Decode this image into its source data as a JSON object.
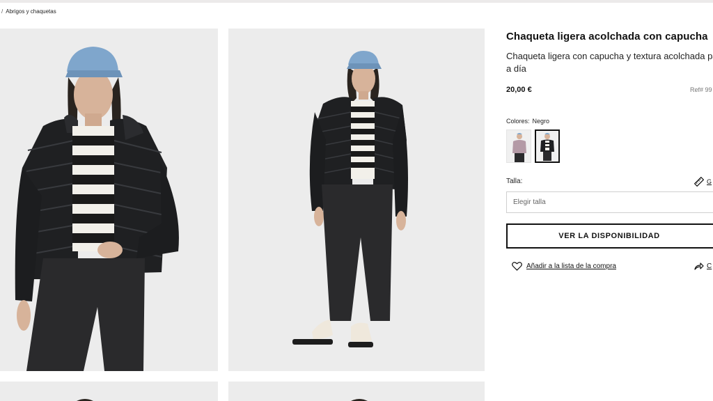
{
  "breadcrumb": {
    "separator": "/",
    "current": "Abrigos y chaquetas"
  },
  "product": {
    "title": "Chaqueta ligera acolchada con capucha",
    "description": "Chaqueta ligera con capucha y textura acolchada pa día a día",
    "price": "20,00 €",
    "ref": "Ref# 99"
  },
  "colors": {
    "label": "Colores:",
    "selected": "Negro",
    "options": [
      {
        "name": "mauve",
        "jacket_color": "#b49aa6"
      },
      {
        "name": "black",
        "jacket_color": "#1f2022"
      }
    ]
  },
  "size": {
    "label": "Talla:",
    "guide_label": "G",
    "placeholder": "Elegir talla"
  },
  "actions": {
    "availability_label": "VER LA DISPONIBILIDAD",
    "wishlist_label": "Añadir a la lista de la compra",
    "share_label": "C"
  },
  "palette": {
    "photo_bg": "#ececec",
    "jacket": "#1f2022",
    "denim_cap": "#7fa6cc",
    "stripe_light": "#f2f0ea",
    "jeans": "#2a2a2c",
    "shoe": "#efe8dc"
  }
}
